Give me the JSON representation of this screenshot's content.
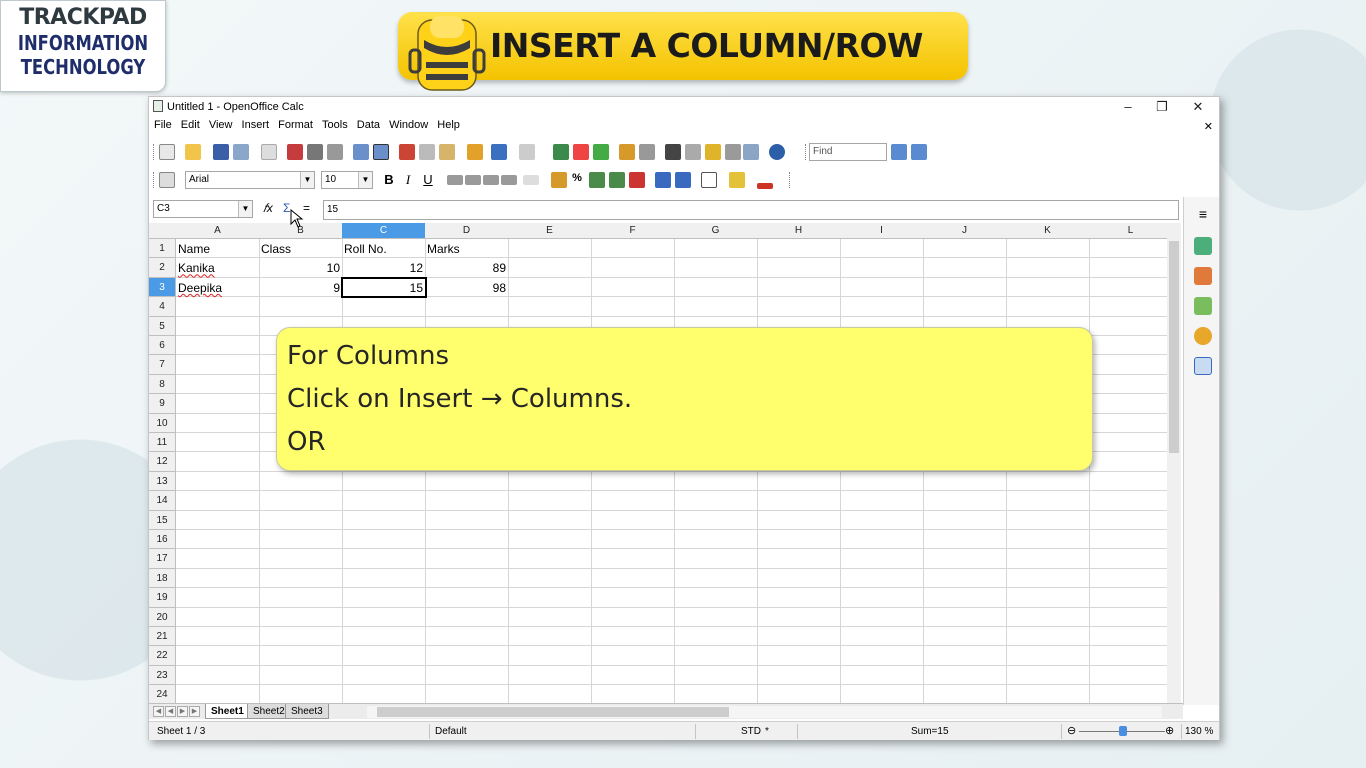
{
  "logo": {
    "line1": "TRACKPAD",
    "line2": "INFORMATION",
    "line3": "TECHNOLOGY"
  },
  "banner": {
    "title": "INSERT A COLUMN/ROW"
  },
  "window": {
    "title": "Untitled 1 - OpenOffice Calc",
    "controls": {
      "minimize": "–",
      "restore": "❐",
      "close": "✕"
    }
  },
  "menu": [
    "File",
    "Edit",
    "View",
    "Insert",
    "Format",
    "Tools",
    "Data",
    "Window",
    "Help"
  ],
  "toolbar": {
    "find_placeholder": "Find",
    "font_name": "Arial",
    "font_size": "10",
    "bold": "B",
    "italic": "I",
    "underline": "U",
    "percent": "%"
  },
  "formula_bar": {
    "name_box": "C3",
    "content": "15",
    "equals": "="
  },
  "grid": {
    "columns": [
      "A",
      "B",
      "C",
      "D",
      "E",
      "F",
      "G",
      "H",
      "I",
      "J",
      "K",
      "L"
    ],
    "rows": [
      "1",
      "2",
      "3",
      "4",
      "5",
      "6",
      "7",
      "8",
      "9",
      "10",
      "11",
      "12",
      "13",
      "14",
      "15",
      "16",
      "17",
      "18",
      "19",
      "20",
      "21",
      "22",
      "23",
      "24"
    ],
    "selected_column": "C",
    "selected_row": "3",
    "cells": {
      "a1": "Name",
      "b1": "Class",
      "c1": "Roll No.",
      "d1": "Marks",
      "a2": "Kanika",
      "b2": "10",
      "c2": "12",
      "d2": "89",
      "a3": "Deepika",
      "b3": "9",
      "c3": "15",
      "d3": "98"
    }
  },
  "sheets": [
    "Sheet1",
    "Sheet2",
    "Sheet3"
  ],
  "status": {
    "sheet": "Sheet 1 / 3",
    "style": "Default",
    "mode": "STD",
    "modified": "*",
    "sum": "Sum=15",
    "zoom": "130 %",
    "zoom_minus": "⊖",
    "zoom_plus": "⊕"
  },
  "callout": {
    "line1": "For Columns",
    "line2": "Click on Insert → Columns.",
    "line3": "OR"
  }
}
